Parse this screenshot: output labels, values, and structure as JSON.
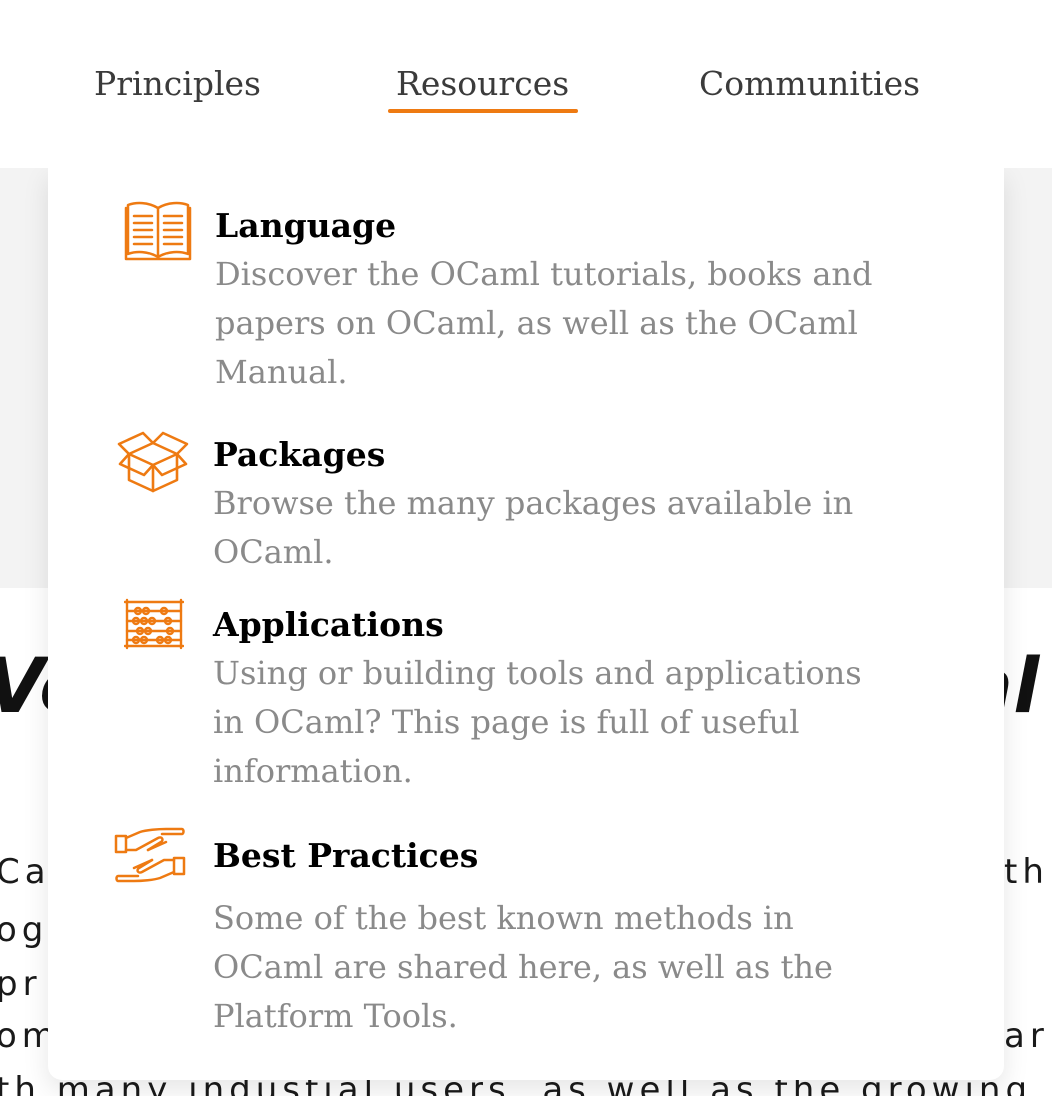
{
  "nav": {
    "items": [
      {
        "label": "Principles"
      },
      {
        "label": "Resources"
      },
      {
        "label": "Communities"
      }
    ],
    "active_index": 1
  },
  "colors": {
    "accent": "#ee7a12",
    "text_muted": "#8a8a8a",
    "nav_text": "#3b3b3b"
  },
  "dropdown": {
    "items": [
      {
        "icon": "book-icon",
        "title": "Language",
        "desc_lines": [
          "Discover the OCaml tutorials, books and",
          "papers on OCaml, as well as the OCaml",
          "Manual."
        ]
      },
      {
        "icon": "package-box-icon",
        "title": "Packages",
        "desc_lines": [
          "Browse the many packages available in",
          "OCaml."
        ]
      },
      {
        "icon": "abacus-icon",
        "title": "Applications",
        "desc_lines": [
          "Using or building tools and applications",
          "in OCaml? This page is full of useful",
          "information."
        ]
      },
      {
        "icon": "handshake-icon",
        "title": "Best Practices",
        "desc_lines": [
          "Some of the best known methods in",
          "OCaml are shared here, as well as the",
          "Platform Tools."
        ]
      }
    ]
  },
  "background": {
    "heading_left": "Ve",
    "heading_right": "al",
    "left_lines": [
      "Ca",
      "og",
      "pr",
      "om",
      "th many industial users, as well as the growing"
    ],
    "right_lines": [
      "th",
      "ar"
    ]
  }
}
